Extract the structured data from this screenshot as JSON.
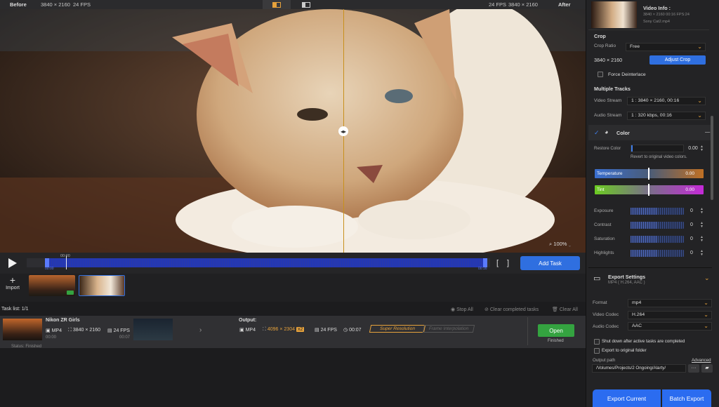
{
  "topbar": {
    "before": "Before",
    "res_left": "3840 × 2160",
    "fps_left": "24 FPS",
    "fps_right": "24 FPS",
    "res_right": "3840 × 2160",
    "after": "After"
  },
  "preview": {
    "zoom": "100%"
  },
  "timeline": {
    "current": "00:00",
    "start": "00:00",
    "end": "00:16",
    "add_task": "Add Task"
  },
  "strip": {
    "import": "Import"
  },
  "task_list": {
    "title": "Task list: 1/1",
    "stop_all": "Stop All",
    "clear_completed": "Clear completed tasks",
    "clear_all": "Clear All"
  },
  "task": {
    "name": "Nikon ZR Girls",
    "format": "MP4",
    "resolution": "3840 × 2160",
    "fps": "24 FPS",
    "time_start": "00:00",
    "time_end": "00:07",
    "status": "Status: Finished",
    "output_label": "Output:",
    "out_format": "MP4",
    "out_resolution": "4096 × 2304",
    "scale": "x2",
    "out_fps": "24 FPS",
    "out_duration": "00:07",
    "super_resolution": "Super Resolution",
    "frame_interpolation": "Frame Interpolation",
    "open": "Open",
    "finished": "Finished"
  },
  "sidebar": {
    "video_info": {
      "title": "Video Info :",
      "line1": "3840 × 2160 00:16 FPS:24",
      "line2": "Sony Cat2.mp4"
    },
    "crop": {
      "title": "Crop",
      "ratio_label": "Crop Ratio",
      "ratio_value": "Free",
      "size": "3840 × 2160",
      "adjust": "Adjust Crop",
      "deinterlace": "Force Deinterlace"
    },
    "tracks": {
      "title": "Multiple Tracks",
      "video_label": "Video Stream",
      "video_value": "1 : 3840 × 2160, 00:16",
      "audio_label": "Audio Stream",
      "audio_value": "1 : 320 kbps, 00:16"
    },
    "color": {
      "title": "Color",
      "restore_label": "Restore Color",
      "restore_value": "0.00",
      "hint": "Revert to original video colors.",
      "temperature": "Temperature",
      "temperature_value": "0.00",
      "tint": "Tint",
      "tint_value": "0.00"
    },
    "adjustments": [
      {
        "label": "Exposure",
        "value": "0",
        "level": 0.5
      },
      {
        "label": "Contrast",
        "value": "0",
        "level": 0.5
      },
      {
        "label": "Saturation",
        "value": "0",
        "level": 0.5
      },
      {
        "label": "Highlights",
        "value": "0",
        "level": 0.5
      }
    ],
    "export": {
      "title": "Export Settings",
      "subtitle": "MP4 ( H.264, AAC )",
      "format_label": "Format",
      "format_value": "mp4",
      "vcodec_label": "Video Codec",
      "vcodec_value": "H.264",
      "acodec_label": "Audio Codec",
      "acodec_value": "AAC",
      "shutdown": "Shut down after active tasks are completed",
      "to_original": "Export to original folder",
      "output_label": "Output path",
      "advanced": "Advanced",
      "path": "/Volumes/Projects/2 Ongoing/Alarty/",
      "more": "···"
    },
    "export_current": "Export Current",
    "batch_export": "Batch Export"
  },
  "colors": {
    "accent": "#2f6fe0",
    "orange": "#e6a23c",
    "green": "#34a340"
  }
}
